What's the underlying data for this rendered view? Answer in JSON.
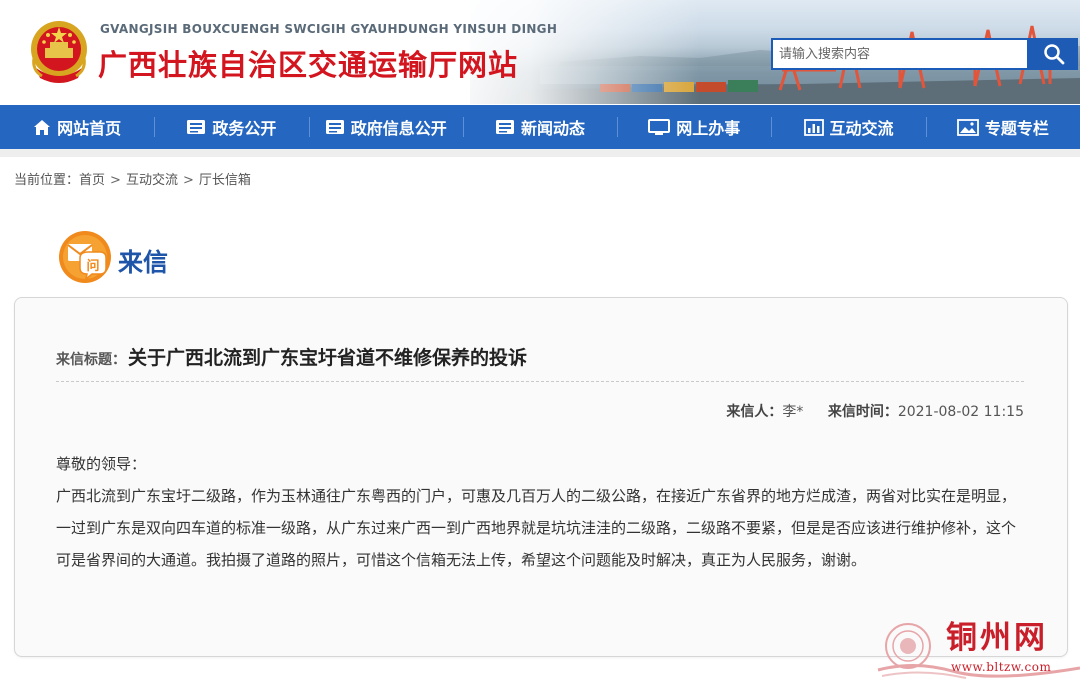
{
  "header": {
    "pinyin": "GVANGJSIH BOUXCUENGH SWCIGIH GYAUHDUNGH YINSUH DINGH",
    "title": "广西壮族自治区交通运输厅网站",
    "search_placeholder": "请输入搜索内容"
  },
  "nav": {
    "items": [
      {
        "label": "网站首页",
        "icon": "home-icon"
      },
      {
        "label": "政务公开",
        "icon": "document-icon"
      },
      {
        "label": "政府信息公开",
        "icon": "document-icon"
      },
      {
        "label": "新闻动态",
        "icon": "document-icon"
      },
      {
        "label": "网上办事",
        "icon": "monitor-icon"
      },
      {
        "label": "互动交流",
        "icon": "chart-icon"
      },
      {
        "label": "专题专栏",
        "icon": "image-icon"
      }
    ]
  },
  "breadcrumb": {
    "prefix": "当前位置：",
    "items": [
      "首页",
      "互动交流",
      "厅长信箱"
    ],
    "separator": ">"
  },
  "letter": {
    "heading": "来信",
    "icon_glyph": "问",
    "title_label": "来信标题：",
    "title": "关于广西北流到广东宝圩省道不维修保养的投诉",
    "sender_label": "来信人：",
    "sender": "李*",
    "time_label": "来信时间：",
    "time": "2021-08-02 11:15",
    "greeting": "尊敬的领导：",
    "body": "广西北流到广东宝圩二级路，作为玉林通往广东粤西的门户，可惠及几百万人的二级公路，在接近广东省界的地方烂成渣，两省对比实在是明显，一过到广东是双向四车道的标准一级路，从广东过来广西一到广西地界就是坑坑洼洼的二级路，二级路不要紧，但是是否应该进行维护修补，这个可是省界间的大通道。我拍摄了道路的照片，可惜这个信箱无法上传，希望这个问题能及时解决，真正为人民服务，谢谢。"
  },
  "watermark": {
    "text": "铜州网",
    "url": "www.bltzw.com"
  },
  "colors": {
    "nav_bg": "#2466c0",
    "title_red": "#d2151e",
    "heading_blue": "#1f55a8",
    "watermark_red": "#c91f2a"
  }
}
